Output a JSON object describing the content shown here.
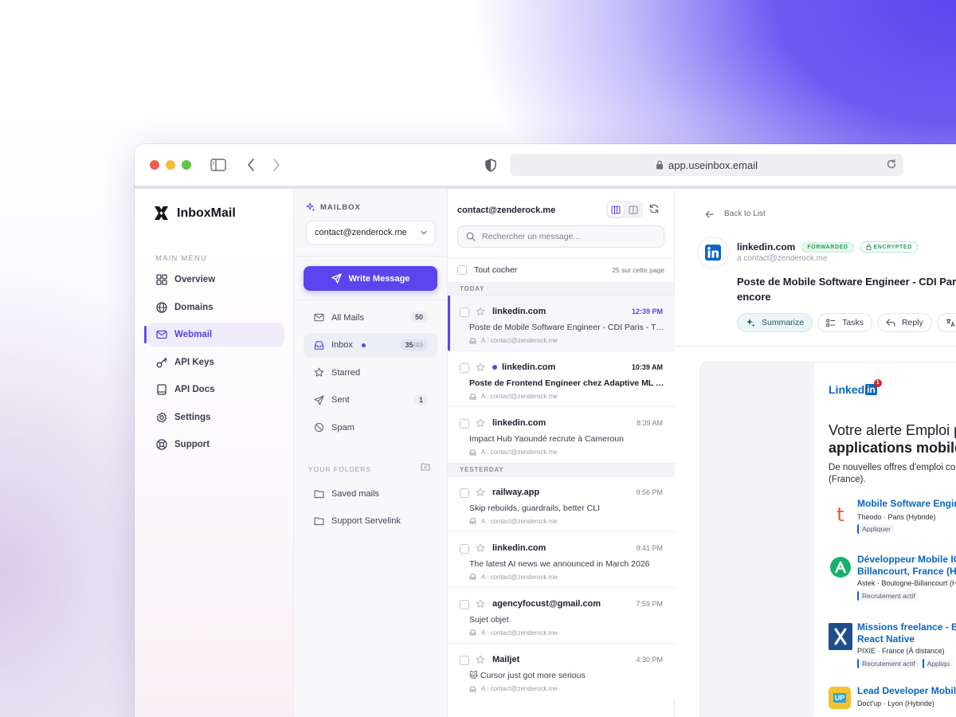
{
  "browser": {
    "url": "app.useinbox.email"
  },
  "app": {
    "name": "InboxMail",
    "menu_title": "MAIN MENU",
    "nav": [
      {
        "label": "Overview",
        "icon": "grid-icon",
        "active": false
      },
      {
        "label": "Domains",
        "icon": "globe-icon",
        "active": false
      },
      {
        "label": "Webmail",
        "icon": "mail-icon",
        "active": true
      },
      {
        "label": "API Keys",
        "icon": "key-icon",
        "active": false
      },
      {
        "label": "API Docs",
        "icon": "book-icon",
        "active": false
      },
      {
        "label": "Settings",
        "icon": "gear-icon",
        "active": false
      },
      {
        "label": "Support",
        "icon": "lifebuoy-icon",
        "active": false
      }
    ]
  },
  "mailbox": {
    "title": "MAILBOX",
    "selected_account": "contact@zenderock.me",
    "write_label": "Write Message",
    "folders": [
      {
        "label": "All Mails",
        "icon": "mail-icon",
        "count": "50",
        "count_total": ""
      },
      {
        "label": "Inbox",
        "icon": "inbox-icon",
        "count": "35",
        "count_total": "/49",
        "unread_dot": true
      },
      {
        "label": "Starred",
        "icon": "star-icon",
        "count": "",
        "count_total": ""
      },
      {
        "label": "Sent",
        "icon": "send-icon",
        "count": "1",
        "count_total": ""
      },
      {
        "label": "Spam",
        "icon": "spam-icon",
        "count": "",
        "count_total": ""
      }
    ],
    "your_folders_title": "YOUR FOLDERS",
    "custom_folders": [
      "Saved mails",
      "Support Servelink"
    ]
  },
  "list": {
    "account": "contact@zenderock.me",
    "search_placeholder": "Rechercher un message...",
    "select_all": "Tout cocher",
    "per_page": "25 sur cette page",
    "today_label": "TODAY",
    "yesterday_label": "YESTERDAY",
    "today": [
      {
        "sender": "linkedin.com",
        "time": "12:39 PM",
        "subject": "Poste de Mobile Software Engineer - CDI Paris - The...",
        "to": "A : contact@zenderock.me",
        "active": true,
        "unread": false,
        "dot": false
      },
      {
        "sender": "linkedin.com",
        "time": "10:39 AM",
        "subject": "Poste de Frontend Engineer chez Adaptive ML et...",
        "to": "A : contact@zenderock.me",
        "active": false,
        "unread": true,
        "dot": true
      },
      {
        "sender": "linkedin.com",
        "time": "8:39 AM",
        "subject": "Impact Hub Yaoundé recrute à Cameroun",
        "to": "A : contact@zenderock.me",
        "active": false,
        "unread": false,
        "dot": false
      }
    ],
    "yesterday": [
      {
        "sender": "railway.app",
        "time": "9:56 PM",
        "subject": "Skip rebuilds, guardrails, better CLI",
        "to": "A : contact@zenderock.me"
      },
      {
        "sender": "linkedin.com",
        "time": "9:41 PM",
        "subject": "The latest AI news we announced in March 2026",
        "to": "A : contact@zenderock.me"
      },
      {
        "sender": "agencyfocust@gmail.com",
        "time": "7:59 PM",
        "subject": "Sujet objet",
        "to": "A : contact@zenderock.me"
      },
      {
        "sender": "Mailjet",
        "time": "4:30 PM",
        "subject": "🐱 Cursor just got more serious",
        "to": "A : contact@zenderock.me"
      }
    ]
  },
  "reader": {
    "back_label": "Back to List",
    "from": "linkedin.com",
    "badge_forwarded": "FORWARDED",
    "badge_encrypted": "ENCRYPTED",
    "to": "a contact@zenderock.me",
    "subject": "Poste de Mobile Software Engineer - CDI Paris - encore",
    "actions": {
      "summarize": "Summarize",
      "tasks": "Tasks",
      "reply": "Reply"
    },
    "email": {
      "brand": "Linked",
      "brand_in": "in",
      "notif_count": "1",
      "alert_line1": "Votre alerte Emploi p",
      "alert_line2": "applications mobiles",
      "desc_line1": "De nouvelles offres d'emploi co",
      "desc_line2": "(France).",
      "jobs": [
        {
          "title": "Mobile Software Engine",
          "title2": "",
          "meta": "Theodo · Paris (Hybride)",
          "tags": [
            "Appliquer"
          ],
          "logo": "t",
          "logo_color": "#e8532f"
        },
        {
          "title": "Développeur Mobile IO",
          "title2": "Billancourt, France (H/F",
          "meta": "Astek · Boulogne-Billancourt (Hy",
          "tags": [
            "Recrutement actif"
          ],
          "logo": "A",
          "logo_color": "#17b26a"
        },
        {
          "title": "Missions freelance - Ba",
          "title2": "React Native",
          "meta": "PIXIE · France (À distance)",
          "tags": [
            "Recrutement actif",
            "Appliqu"
          ],
          "logo": "X",
          "logo_color": "#1f4e8c"
        },
        {
          "title": "Lead Developer Mobile",
          "title2": "",
          "meta": "Doct'up · Lyon (Hybride)",
          "tags": [],
          "logo": "UP",
          "logo_color": "#f2c230"
        }
      ]
    }
  }
}
